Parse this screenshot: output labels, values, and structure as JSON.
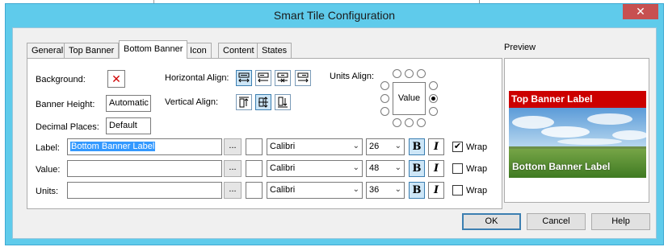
{
  "window": {
    "title": "Smart Tile Configuration",
    "close_glyph": "✕"
  },
  "tabs": [
    {
      "label": "General"
    },
    {
      "label": "Top Banner"
    },
    {
      "label": "Bottom Banner",
      "active": true
    },
    {
      "label": "Icon"
    },
    {
      "label": "Content"
    },
    {
      "label": "States"
    }
  ],
  "panel": {
    "background_label": "Background:",
    "background_glyph": "✕",
    "banner_height_label": "Banner Height:",
    "banner_height_value": "Automatic",
    "decimal_places_label": "Decimal Places:",
    "decimal_places_value": "Default",
    "horizontal_align_label": "Horizontal Align:",
    "vertical_align_label": "Vertical Align:",
    "units_align_label": "Units Align:",
    "units_align_box": "Value",
    "units_align_selected": "right"
  },
  "rows": [
    {
      "label": "Label:",
      "text": "Bottom Banner Label",
      "ellipsis": "...",
      "font": "Calibri",
      "size": "26",
      "bold": "B",
      "italic": "I",
      "wrap_label": "Wrap",
      "wrap_checked": true,
      "check_glyph": "✔",
      "dropdown_glyph": "⌄"
    },
    {
      "label": "Value:",
      "text": "",
      "ellipsis": "...",
      "font": "Calibri",
      "size": "48",
      "bold": "B",
      "italic": "I",
      "wrap_label": "Wrap",
      "wrap_checked": false,
      "check_glyph": "",
      "dropdown_glyph": "⌄"
    },
    {
      "label": "Units:",
      "text": "",
      "ellipsis": "...",
      "font": "Calibri",
      "size": "36",
      "bold": "B",
      "italic": "I",
      "wrap_label": "Wrap",
      "wrap_checked": false,
      "check_glyph": "",
      "dropdown_glyph": "⌄"
    }
  ],
  "preview": {
    "label": "Preview",
    "top_banner_label": "Top Banner Label",
    "bottom_banner_label": "Bottom Banner Label"
  },
  "buttons": {
    "ok": "OK",
    "cancel": "Cancel",
    "help": "Help"
  },
  "colors": {
    "title_bar": "#5fcbeb",
    "close_button": "#c75050",
    "top_banner": "#cc0000",
    "selection": "#3399ff",
    "toggle_selected": "#cde6f7"
  }
}
